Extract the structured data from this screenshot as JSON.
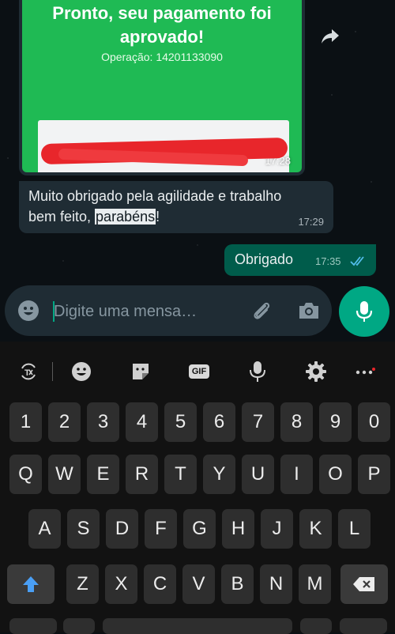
{
  "image_message": {
    "title": "Pronto, seu pagamento foi aprovado!",
    "operation": "Operação: 14201133090",
    "time": "17:28"
  },
  "messages": [
    {
      "direction": "incoming",
      "text_before": "Muito obrigado pela agilidade e trabalho bem feito, ",
      "text_highlight": "parabéns",
      "text_after": "!",
      "time": "17:29"
    },
    {
      "direction": "outgoing",
      "text": "Obrigado",
      "time": "17:35",
      "status": "read"
    }
  ],
  "composer": {
    "placeholder": "Digite uma mensa…",
    "value": ""
  },
  "icons": {
    "forward": "forward-icon",
    "emoji": "emoji-icon",
    "attach": "paperclip-icon",
    "camera": "camera-icon",
    "mic": "mic-icon"
  },
  "keyboard": {
    "toolbar": [
      "translate-icon",
      "emoji-icon",
      "sticker-icon",
      "gif-icon",
      "voice-icon",
      "settings-icon",
      "more-icon"
    ],
    "gif_label": "GIF",
    "rows": [
      [
        "1",
        "2",
        "3",
        "4",
        "5",
        "6",
        "7",
        "8",
        "9",
        "0"
      ],
      [
        "Q",
        "W",
        "E",
        "R",
        "T",
        "Y",
        "U",
        "I",
        "O",
        "P"
      ],
      [
        "A",
        "S",
        "D",
        "F",
        "G",
        "H",
        "J",
        "K",
        "L"
      ],
      [
        "Z",
        "X",
        "C",
        "V",
        "B",
        "N",
        "M"
      ]
    ]
  },
  "colors": {
    "accent": "#00a884",
    "outgoing_bubble": "#005c4b",
    "incoming_bubble": "#1f2c34",
    "payment_green": "#1fba54",
    "redaction_red": "#e8262b"
  }
}
